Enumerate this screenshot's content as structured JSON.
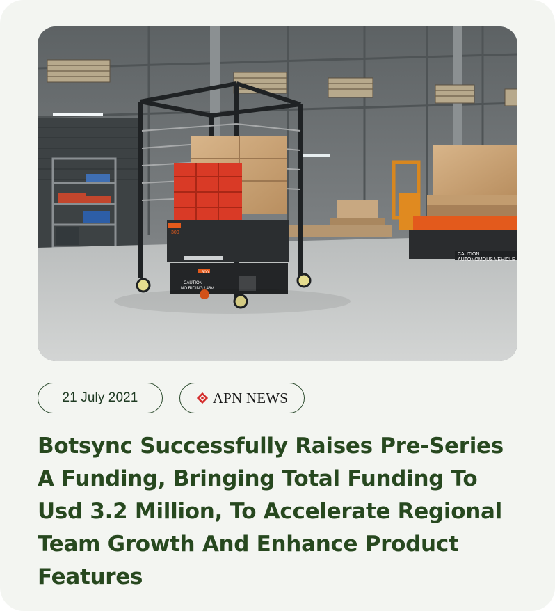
{
  "article": {
    "image_alt": "Autonomous mobile robots carrying crates and a cart in a warehouse",
    "image_labels": {
      "robot_model_1": "300",
      "robot_model_2": "300",
      "caution_label_1": "CAUTION",
      "no_riding_label": "NO RIDING / 48V",
      "caution_label_2": "CAUTION",
      "autonomous_vehicle_label": "AUTONOMOUS VEHICLE"
    },
    "date": "21 July 2021",
    "source": "APN NEWS",
    "title": "Botsync Successfully Raises Pre-Series A Funding, Bringing Total Funding To Usd 3.2 Million, To Accelerate Regional Team Growth And Enhance Product Features"
  },
  "colors": {
    "card_background": "#f3f5f1",
    "title_color": "#27481f",
    "pill_border": "#2a4a2c",
    "source_mark_red": "#d42a2a",
    "robot_orange": "#e35a1c"
  }
}
